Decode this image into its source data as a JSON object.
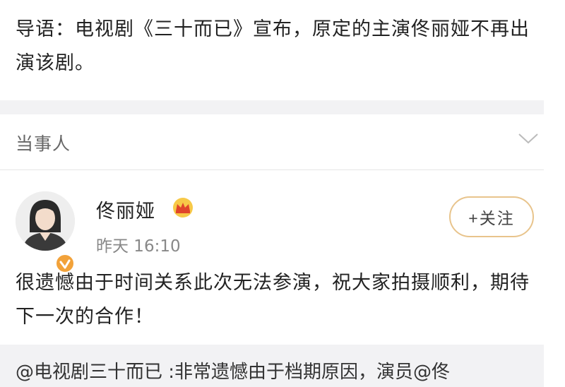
{
  "intro": {
    "text": "导语：电视剧《三十而已》宣布，原定的主演佟丽娅不再出演该剧。"
  },
  "section": {
    "title": "当事人",
    "chevron_icon": "chevron-down-icon"
  },
  "post": {
    "author": "佟丽娅",
    "time": "昨天 16:10",
    "follow_label": "+关注",
    "body": "很遗憾由于时间关系此次无法参演，祝大家拍摄顺利，期待下一次的合作！",
    "avatar_icon": "avatar",
    "vip_icon": "crown-icon",
    "verified_icon": "verified-badge-icon"
  },
  "repost": {
    "text": "@电视剧三十而已 :非常遗憾由于档期原因，演员@佟"
  },
  "colors": {
    "accent_gold": "#e8c48c",
    "badge_orange": "#f2a23a",
    "background_gray": "#f2f2f4"
  }
}
